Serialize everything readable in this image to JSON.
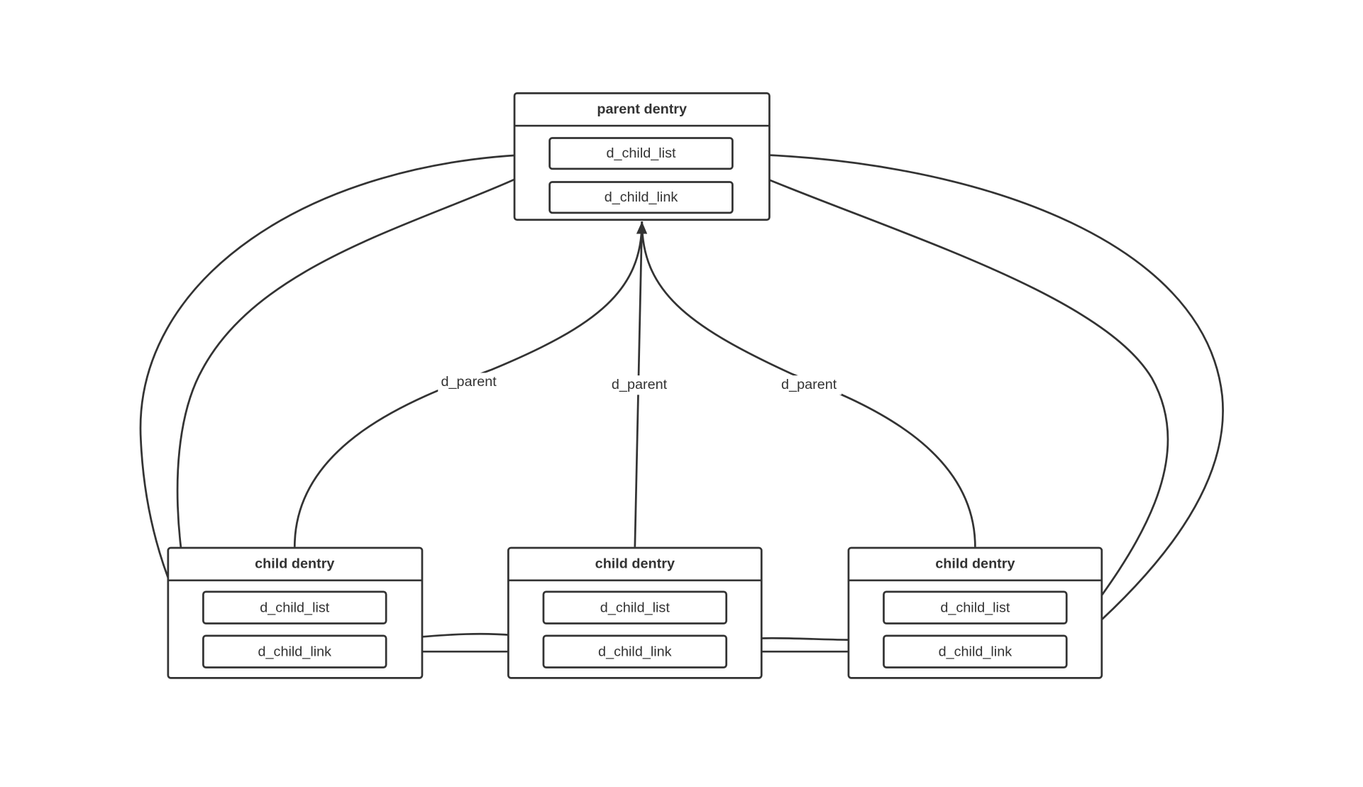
{
  "parent": {
    "title": "parent dentry",
    "fields": [
      "d_child_list",
      "d_child_link"
    ]
  },
  "children": [
    {
      "title": "child dentry",
      "fields": [
        "d_child_list",
        "d_child_link"
      ]
    },
    {
      "title": "child dentry",
      "fields": [
        "d_child_list",
        "d_child_link"
      ]
    },
    {
      "title": "child dentry",
      "fields": [
        "d_child_list",
        "d_child_link"
      ]
    }
  ],
  "edge_labels": [
    "d_parent",
    "d_parent",
    "d_parent"
  ],
  "colors": {
    "stroke": "#333333",
    "background": "#ffffff"
  }
}
